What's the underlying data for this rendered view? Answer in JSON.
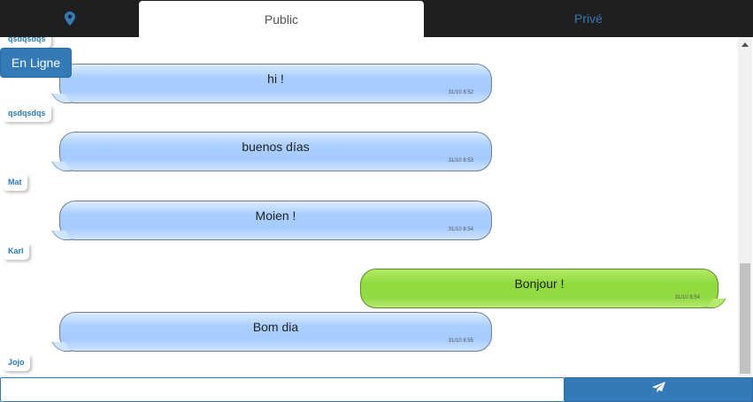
{
  "tabs": {
    "location_icon": "map-marker-icon",
    "public_label": "Public",
    "prive_label": "Privé"
  },
  "online_button": {
    "label": "En Ligne"
  },
  "messages": [
    {
      "sender": "qsdqsdqs",
      "text": "hi !",
      "time": "31/10 8:52",
      "mine": false
    },
    {
      "sender": "qsdqsdqs",
      "text": "buenos días",
      "time": "31/10 8:53",
      "mine": false
    },
    {
      "sender": "Mat",
      "text": "Moien !",
      "time": "31/10 8:54",
      "mine": false
    },
    {
      "sender": "Karl",
      "text": "Bonjour !",
      "time": "31/10 8:54",
      "mine": true
    },
    {
      "sender": "",
      "text": "Bom dia",
      "time": "31/10 8:55",
      "mine": false
    },
    {
      "sender": "Jojo",
      "text": "",
      "time": "",
      "mine": false
    }
  ],
  "composer": {
    "placeholder": "",
    "send_icon": "paper-plane-icon"
  },
  "colors": {
    "accent": "#337ab7",
    "topbar": "#1f1f1f",
    "bubble_other": "#a9ceff",
    "bubble_mine": "#8fd93d"
  }
}
